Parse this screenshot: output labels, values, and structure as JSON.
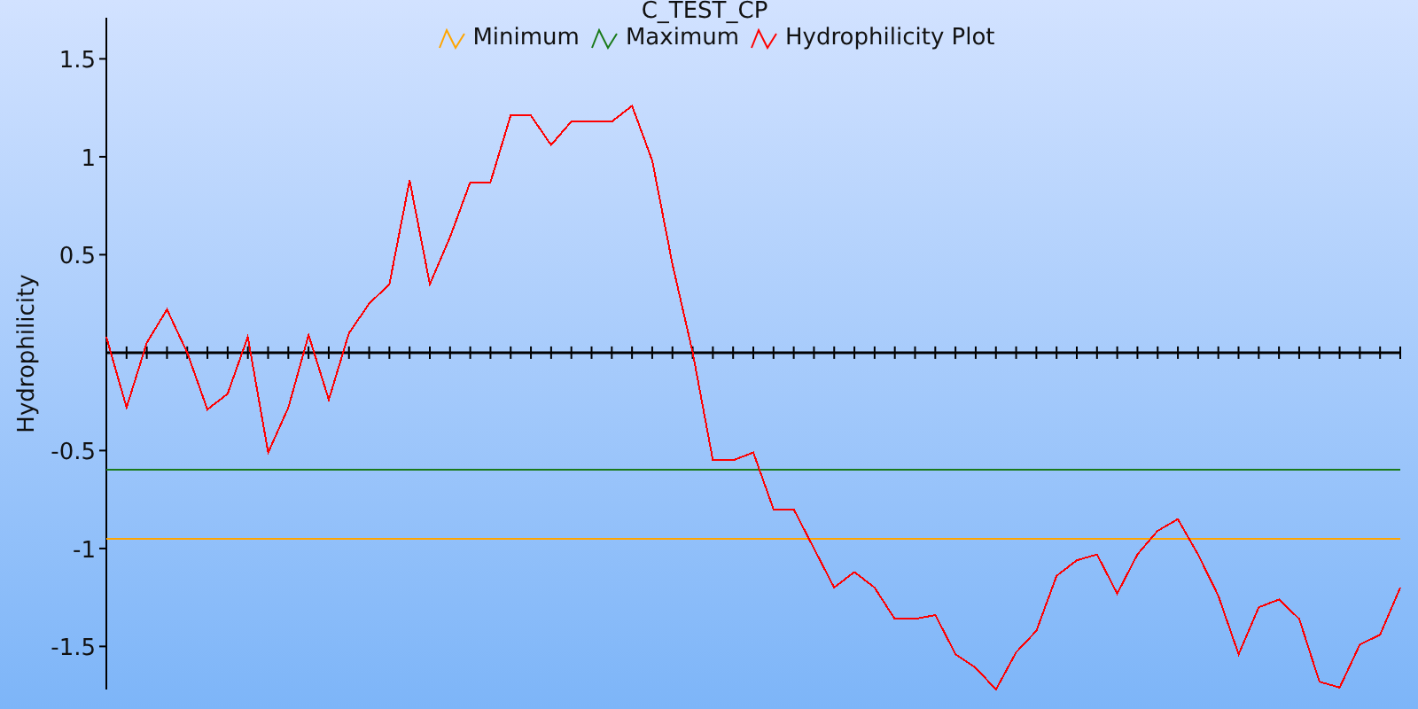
{
  "chart_data": {
    "type": "line",
    "title": "C_TEST_CP",
    "ylabel": "Hydrophilicity",
    "ylim": [
      -1.72,
      1.71
    ],
    "yticks": [
      -1.5,
      -1,
      -0.5,
      0.5,
      1,
      1.5
    ],
    "legend": true,
    "series": [
      {
        "name": "Minimum",
        "color": "#ffa500",
        "values": [
          -0.95,
          -0.95,
          -0.95,
          -0.95,
          -0.95,
          -0.95,
          -0.95,
          -0.95,
          -0.95,
          -0.95,
          -0.95,
          -0.95,
          -0.95,
          -0.95,
          -0.95,
          -0.95,
          -0.95,
          -0.95,
          -0.95,
          -0.95,
          -0.95,
          -0.95,
          -0.95,
          -0.95,
          -0.95,
          -0.95,
          -0.95,
          -0.95,
          -0.95,
          -0.95,
          -0.95,
          -0.95,
          -0.95,
          -0.95,
          -0.95,
          -0.95,
          -0.95,
          -0.95,
          -0.95,
          -0.95,
          -0.95,
          -0.95,
          -0.95,
          -0.95,
          -0.95,
          -0.95,
          -0.95,
          -0.95,
          -0.95,
          -0.95,
          -0.95,
          -0.95,
          -0.95,
          -0.95,
          -0.95,
          -0.95,
          -0.95,
          -0.95,
          -0.95,
          -0.95,
          -0.95,
          -0.95,
          -0.95,
          -0.95,
          -0.95
        ]
      },
      {
        "name": "Maximum",
        "color": "#1a7a1a",
        "values": [
          -0.6,
          -0.6,
          -0.6,
          -0.6,
          -0.6,
          -0.6,
          -0.6,
          -0.6,
          -0.6,
          -0.6,
          -0.6,
          -0.6,
          -0.6,
          -0.6,
          -0.6,
          -0.6,
          -0.6,
          -0.6,
          -0.6,
          -0.6,
          -0.6,
          -0.6,
          -0.6,
          -0.6,
          -0.6,
          -0.6,
          -0.6,
          -0.6,
          -0.6,
          -0.6,
          -0.6,
          -0.6,
          -0.6,
          -0.6,
          -0.6,
          -0.6,
          -0.6,
          -0.6,
          -0.6,
          -0.6,
          -0.6,
          -0.6,
          -0.6,
          -0.6,
          -0.6,
          -0.6,
          -0.6,
          -0.6,
          -0.6,
          -0.6,
          -0.6,
          -0.6,
          -0.6,
          -0.6,
          -0.6,
          -0.6,
          -0.6,
          -0.6,
          -0.6,
          -0.6,
          -0.6,
          -0.6,
          -0.6,
          -0.6,
          -0.6
        ]
      },
      {
        "name": "Hydrophilicity Plot",
        "color": "#ff0000",
        "values": [
          0.08,
          -0.28,
          0.05,
          0.22,
          0.0,
          -0.29,
          -0.21,
          0.08,
          -0.51,
          -0.28,
          0.09,
          -0.24,
          0.1,
          0.25,
          0.35,
          0.88,
          0.35,
          0.59,
          0.87,
          0.87,
          1.21,
          1.21,
          1.06,
          1.18,
          1.18,
          1.18,
          1.26,
          0.98,
          0.45,
          0.0,
          -0.55,
          -0.55,
          -0.51,
          -0.8,
          -0.8,
          -1.0,
          -1.2,
          -1.12,
          -1.2,
          -1.36,
          -1.36,
          -1.34,
          -1.54,
          -1.61,
          -1.72,
          -1.53,
          -1.42,
          -1.14,
          -1.06,
          -1.03,
          -1.23,
          -1.03,
          -0.91,
          -0.85,
          -1.03,
          -1.24,
          -1.54,
          -1.3,
          -1.26,
          -1.36,
          -1.68,
          -1.71,
          -1.49,
          -1.44,
          -1.2
        ]
      }
    ]
  }
}
